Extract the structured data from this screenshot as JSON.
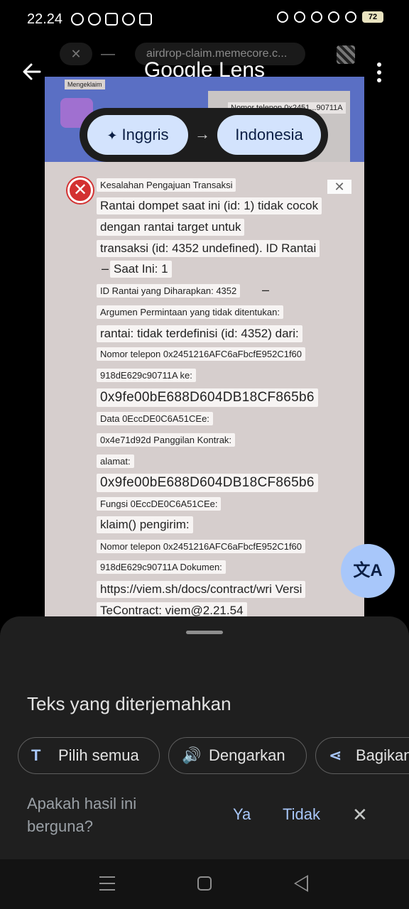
{
  "status_bar": {
    "time": "22.24",
    "battery": "72"
  },
  "browser": {
    "url": "airdrop-claim.memecore.c...",
    "close_glyph": "✕",
    "minimize_glyph": "—"
  },
  "lens": {
    "title": "Google Lens",
    "source_language": "Inggris",
    "target_language": "Indonesia",
    "arrow": "→",
    "sparkle": "✦"
  },
  "image": {
    "chip_label": "Mengeklaim",
    "panel_text": "Nomor telepon 0x2451...90711A"
  },
  "translated": {
    "close": "✕",
    "error_glyph": "✕",
    "dash1": "–",
    "dash2": "–",
    "lines": [
      "Kesalahan Pengajuan Transaksi",
      "Rantai dompet saat ini (id: 1) tidak cocok",
      "dengan rantai target untuk",
      "transaksi (id: 4352 undefined). ID Rantai",
      "Saat Ini: 1",
      "ID Rantai yang Diharapkan: 4352",
      "Argumen Permintaan yang tidak ditentukan:",
      "rantai: tidak terdefinisi (id: 4352) dari:",
      "Nomor telepon 0x2451216AFC6aFbcfE952C1f60",
      "918dE629c90711A ke:",
      "0x9fe00bE688D604DB18CF865b6",
      "Data 0EccDE0C6A51CEe:",
      "0x4e71d92d Panggilan Kontrak:",
      "alamat:",
      "0x9fe00bE688D604DB18CF865b6",
      "Fungsi 0EccDE0C6A51CEe:",
      "klaim() pengirim:",
      "Nomor telepon 0x2451216AFC6aFbcfE952C1f60",
      "918dE629c90711A Dokumen:",
      "https://viem.sh/docs/contract/wri Versi",
      "TeContract: viem@2.21.54"
    ]
  },
  "fab": {
    "glyph": "文A"
  },
  "sheet": {
    "title": "Teks yang diterjemahkan",
    "actions": [
      {
        "icon": "T",
        "label": "Pilih semua"
      },
      {
        "icon": "🔊",
        "label": "Dengarkan"
      },
      {
        "icon": "⋖",
        "label": "Bagikan"
      }
    ],
    "feedback_question": "Apakah hasil ini berguna?",
    "yes": "Ya",
    "no": "Tidak",
    "dismiss": "✕"
  }
}
